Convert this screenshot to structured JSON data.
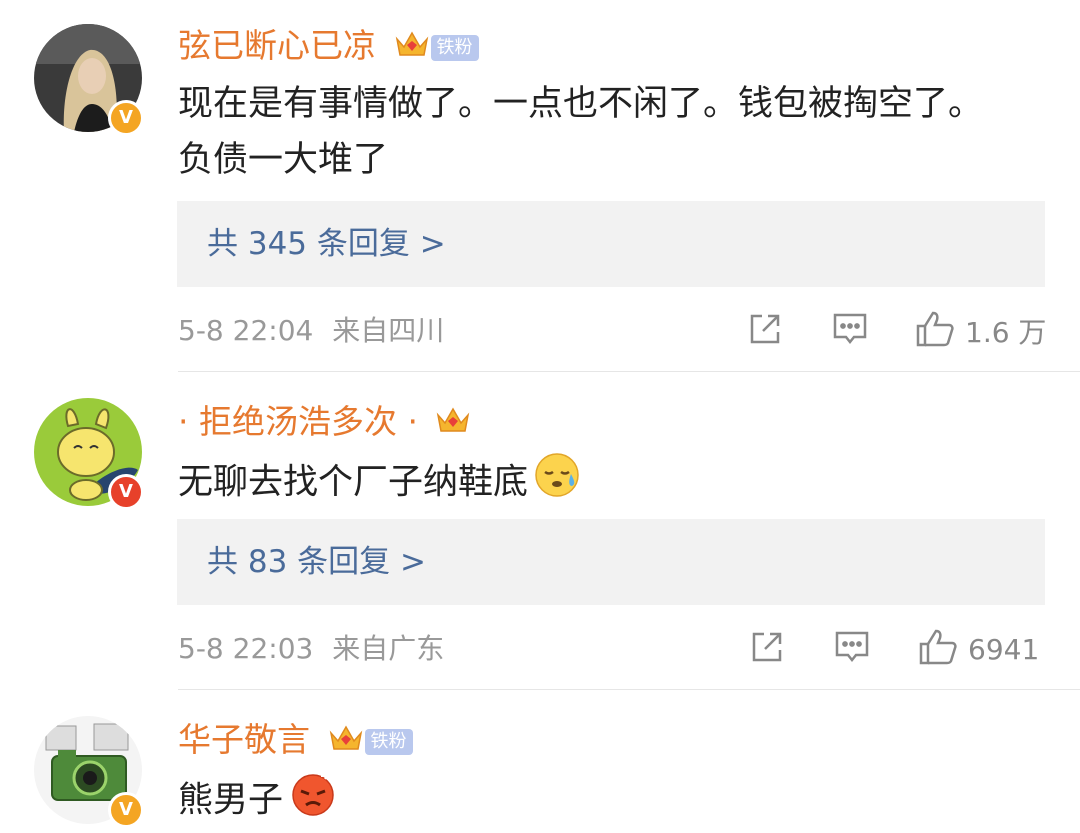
{
  "comments": [
    {
      "username": "弦已断心已凉",
      "badge": "铁粉",
      "verified": "V",
      "text": "现在是有事情做了。一点也不闲了。钱包被掏空了。负债一大堆了",
      "replies": "共 345 条回复 >",
      "time": "5-8 22:04",
      "source": "来自四川",
      "likes": "1.6 万"
    },
    {
      "username": "· 拒绝汤浩多次 ·",
      "verified": "V",
      "text": "无聊去找个厂子纳鞋底",
      "emoji": "sweat-smile-emoji",
      "replies": "共 83 条回复 >",
      "time": "5-8 22:03",
      "source": "来自广东",
      "likes": "6941"
    },
    {
      "username": "华子敬言",
      "badge": "铁粉",
      "verified": "V",
      "text": "熊男子",
      "emoji": "angry-face-emoji"
    }
  ],
  "colors": {
    "username": "#e6792f",
    "reply_link": "#4a6b9a",
    "meta": "#999999",
    "reply_bg": "#f2f2f2",
    "badge_bg": "#b9c8ee",
    "verified_gold": "#f4a523",
    "verified_red": "#e7412a"
  },
  "icons": [
    "share-icon",
    "comment-icon",
    "like-icon",
    "crown-icon"
  ]
}
